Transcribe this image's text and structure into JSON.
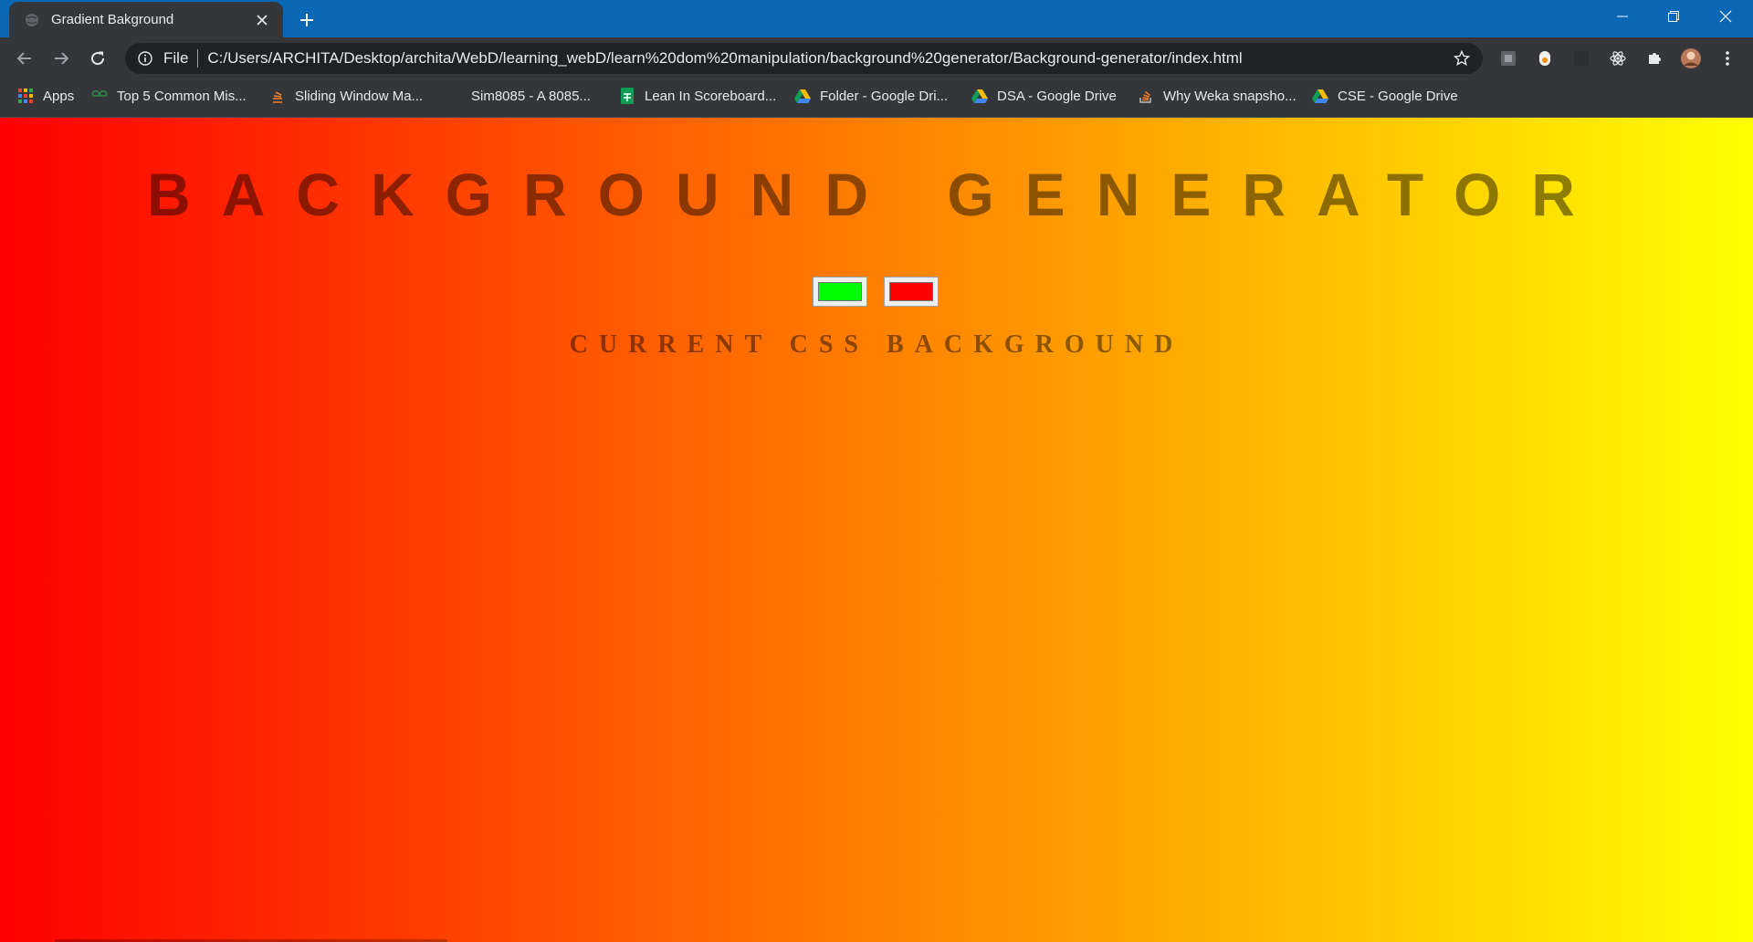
{
  "browser": {
    "tab": {
      "title": "Gradient Bakground"
    },
    "omnibox": {
      "scheme_label": "File",
      "url": "C:/Users/ARCHITA/Desktop/archita/WebD/learning_webD/learn%20dom%20manipulation/background%20generator/Background-generator/index.html"
    },
    "bookmarks": [
      {
        "label": "Apps",
        "icon": "apps-grid-icon"
      },
      {
        "label": "Top 5 Common Mis...",
        "icon": "gfg-icon"
      },
      {
        "label": "Sliding Window Ma...",
        "icon": "stack-icon"
      },
      {
        "label": "Sim8085 - A 8085...",
        "icon": ""
      },
      {
        "label": "Lean In Scoreboard...",
        "icon": "sheets-icon"
      },
      {
        "label": "Folder - Google Dri...",
        "icon": "drive-icon"
      },
      {
        "label": "DSA - Google Drive",
        "icon": "drive-icon"
      },
      {
        "label": "Why Weka snapsho...",
        "icon": "stackoverflow-icon"
      },
      {
        "label": "CSE - Google Drive",
        "icon": "drive-icon"
      }
    ]
  },
  "page": {
    "heading": "BACKGROUND GENERATOR",
    "subheading": "CURRENT CSS BACKGROUND",
    "color1": "#00ff00",
    "color2": "#ff0000",
    "gradient_from": "#ff0000",
    "gradient_to": "#ffff00"
  }
}
